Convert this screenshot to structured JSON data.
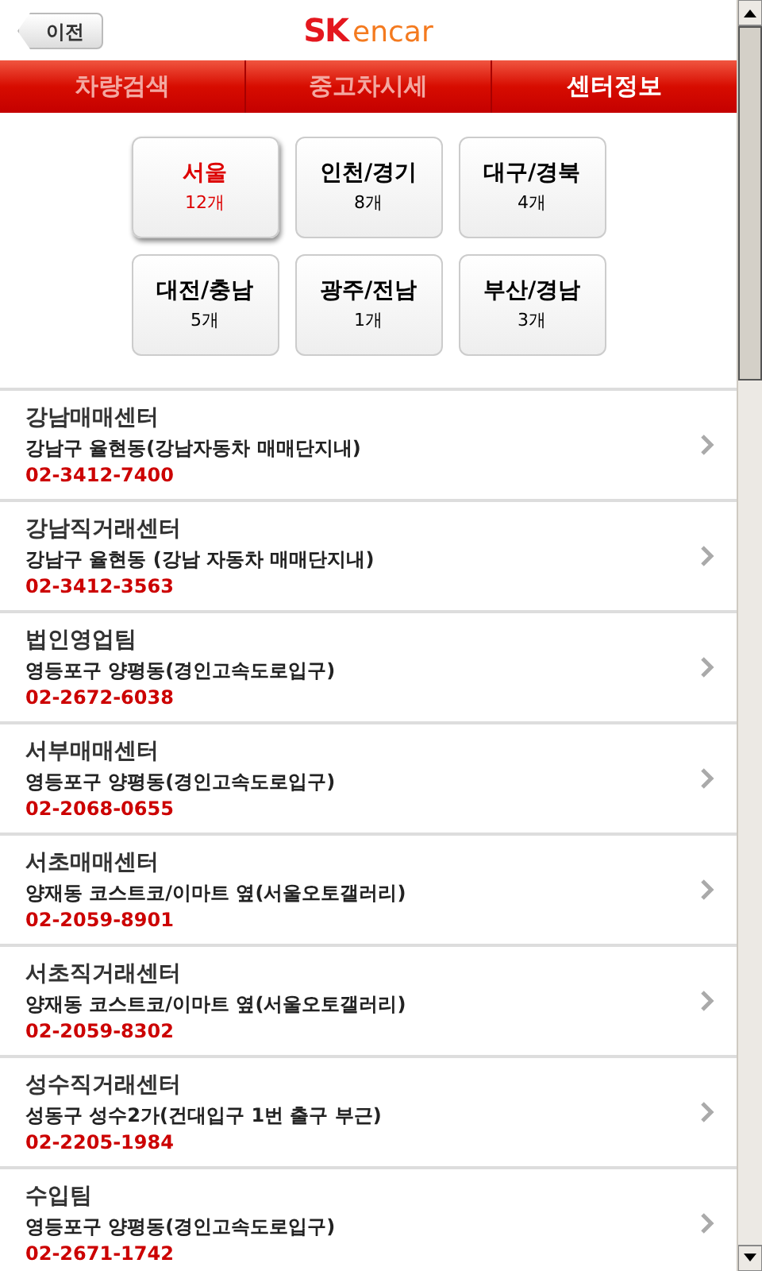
{
  "header": {
    "back_button": "이전",
    "logo": {
      "mark": "SK",
      "name": "encar"
    }
  },
  "tabs": [
    {
      "label": "차량검색",
      "selected": false
    },
    {
      "label": "중고차시세",
      "selected": false
    },
    {
      "label": "센터정보",
      "selected": true
    }
  ],
  "regions": [
    {
      "name": "서울",
      "count": "12개",
      "selected": true
    },
    {
      "name": "인천/경기",
      "count": "8개",
      "selected": false
    },
    {
      "name": "대구/경북",
      "count": "4개",
      "selected": false
    },
    {
      "name": "대전/충남",
      "count": "5개",
      "selected": false
    },
    {
      "name": "광주/전남",
      "count": "1개",
      "selected": false
    },
    {
      "name": "부산/경남",
      "count": "3개",
      "selected": false
    }
  ],
  "centers": [
    {
      "name": "강남매매센터",
      "address": "강남구 율현동(강남자동차 매매단지내)",
      "phone": "02-3412-7400"
    },
    {
      "name": "강남직거래센터",
      "address": "강남구 율현동 (강남 자동차 매매단지내)",
      "phone": "02-3412-3563"
    },
    {
      "name": "법인영업팀",
      "address": "영등포구 양평동(경인고속도로입구)",
      "phone": "02-2672-6038"
    },
    {
      "name": "서부매매센터",
      "address": "영등포구 양평동(경인고속도로입구)",
      "phone": "02-2068-0655"
    },
    {
      "name": "서초매매센터",
      "address": "양재동 코스트코/이마트 옆(서울오토갤러리)",
      "phone": "02-2059-8901"
    },
    {
      "name": "서초직거래센터",
      "address": "양재동 코스트코/이마트 옆(서울오토갤러리)",
      "phone": "02-2059-8302"
    },
    {
      "name": "성수직거래센터",
      "address": "성동구 성수2가(건대입구 1번 출구 부근)",
      "phone": "02-2205-1984"
    },
    {
      "name": "수입팀",
      "address": "영등포구 양평동(경인고속도로입구)",
      "phone": "02-2671-1742"
    }
  ]
}
